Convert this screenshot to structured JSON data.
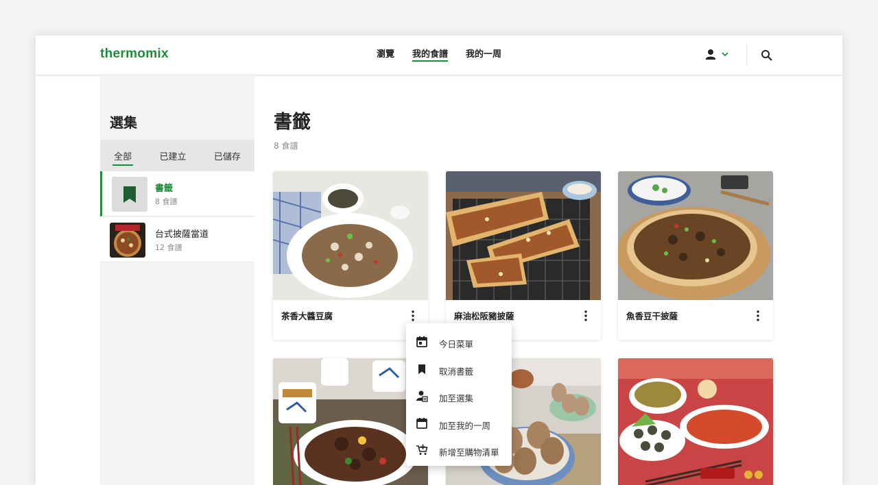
{
  "header": {
    "logo": "thermomix",
    "nav": [
      {
        "label": "瀏覽",
        "active": false
      },
      {
        "label": "我的食譜",
        "active": true
      },
      {
        "label": "我的一周",
        "active": false
      }
    ],
    "accent_color": "#1f8a3c"
  },
  "sidebar": {
    "title": "選集",
    "tabs": [
      {
        "label": "全部",
        "active": true
      },
      {
        "label": "已建立",
        "active": false
      },
      {
        "label": "已儲存",
        "active": false
      }
    ],
    "items": [
      {
        "name": "書籤",
        "count": "8 食譜",
        "selected": true,
        "icon": "bookmark-icon"
      },
      {
        "name": "台式披薩當道",
        "count": "12 食譜",
        "selected": false,
        "icon": "pizza-thumbnail"
      }
    ]
  },
  "main": {
    "title": "書籤",
    "count": "8 食譜",
    "recipes": [
      {
        "name": "茶香大醬豆腐",
        "image": "tofu-dish"
      },
      {
        "name": "麻油松阪豬披薩",
        "image": "pork-pizza"
      },
      {
        "name": "魚香豆干披薩",
        "image": "tofu-pizza"
      },
      {
        "name": "",
        "image": "braised-meat"
      },
      {
        "name": "",
        "image": "tea-eggs"
      },
      {
        "name": "",
        "image": "festive-dishes"
      }
    ]
  },
  "context_menu": {
    "items": [
      {
        "label": "今日菜單",
        "icon": "calendar-today-icon"
      },
      {
        "label": "取消書籤",
        "icon": "bookmark-icon"
      },
      {
        "label": "加至選集",
        "icon": "add-collection-icon"
      },
      {
        "label": "加至我的一周",
        "icon": "calendar-icon"
      },
      {
        "label": "新增至購物清單",
        "icon": "cart-add-icon"
      }
    ]
  }
}
